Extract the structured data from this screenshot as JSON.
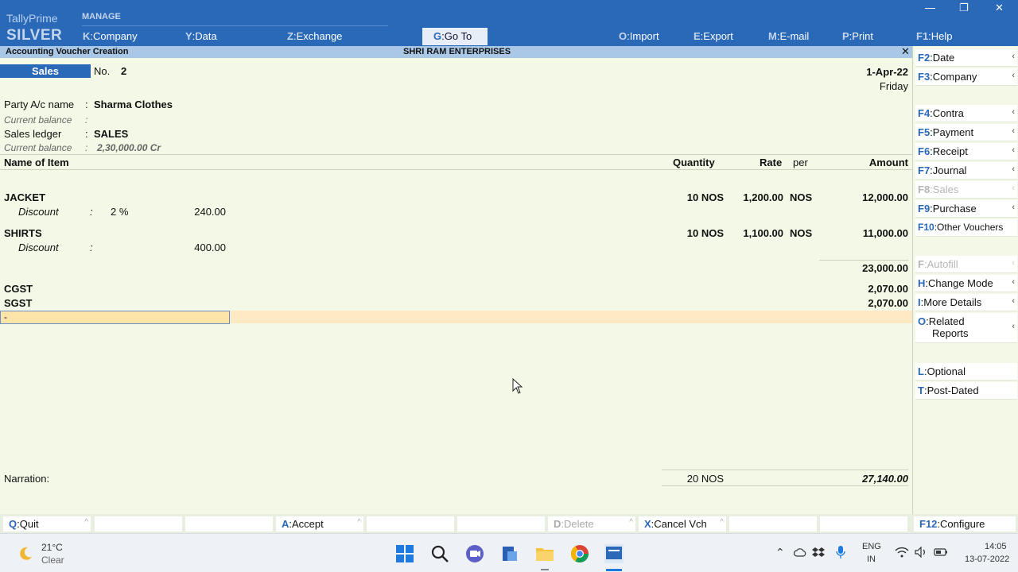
{
  "brand": {
    "line1": "TallyPrime",
    "line2": "SILVER"
  },
  "topmenu": {
    "manage_label": "MANAGE",
    "items": [
      {
        "key": "K",
        "label": "Company"
      },
      {
        "key": "Y",
        "label": "Data"
      },
      {
        "key": "Z",
        "label": "Exchange"
      },
      {
        "key": "G",
        "label": "Go To"
      },
      {
        "key": "O",
        "label": "Import"
      },
      {
        "key": "E",
        "label": "Export"
      },
      {
        "key": "M",
        "label": "E-mail"
      },
      {
        "key": "P",
        "label": "Print"
      },
      {
        "key": "F1",
        "label": "Help"
      }
    ]
  },
  "window": {
    "minimize": "—",
    "restore": "❐",
    "close": "✕"
  },
  "titlebar": {
    "screen": "Accounting Voucher Creation",
    "company": "SHRI RAM ENTERPRISES",
    "close": "✕"
  },
  "voucher": {
    "type": "Sales",
    "no_label": "No.",
    "no": "2",
    "date": "1-Apr-22",
    "day": "Friday",
    "party_label": "Party A/c name",
    "party": "Sharma Clothes",
    "current_balance_label": "Current balance",
    "party_balance": "",
    "sales_ledger_label": "Sales ledger",
    "sales_ledger": "SALES",
    "ledger_balance": "2,30,000.00 Cr",
    "colon": ":"
  },
  "columns": {
    "name": "Name of Item",
    "quantity": "Quantity",
    "rate": "Rate",
    "per": "per",
    "amount": "Amount"
  },
  "items": [
    {
      "name": "JACKET",
      "qty": "10 NOS",
      "rate": "1,200.00",
      "per": "NOS",
      "amount": "12,000.00",
      "disc_label": "Discount",
      "disc_pct": "2 %",
      "disc_amt": "240.00"
    },
    {
      "name": "SHIRTS",
      "qty": "10 NOS",
      "rate": "1,100.00",
      "per": "NOS",
      "amount": "11,000.00",
      "disc_label": "Discount",
      "disc_pct": "",
      "disc_amt": "400.00"
    }
  ],
  "subtotal": "23,000.00",
  "taxes": [
    {
      "name": "CGST",
      "amount": "2,070.00"
    },
    {
      "name": "SGST",
      "amount": "2,070.00"
    }
  ],
  "active_input": "-",
  "footer": {
    "narration_label": "Narration:",
    "total_qty": "20 NOS",
    "total_amount": "27,140.00"
  },
  "rightpanel": [
    {
      "key": "F2",
      "label": "Date"
    },
    {
      "key": "F3",
      "label": "Company"
    },
    {
      "key": "F4",
      "label": "Contra"
    },
    {
      "key": "F5",
      "label": "Payment"
    },
    {
      "key": "F6",
      "label": "Receipt"
    },
    {
      "key": "F7",
      "label": "Journal"
    },
    {
      "key": "F8",
      "label": "Sales"
    },
    {
      "key": "F9",
      "label": "Purchase"
    },
    {
      "key": "F10",
      "label": "Other Vouchers"
    },
    {
      "key": "F",
      "label": "Autofill"
    },
    {
      "key": "H",
      "label": "Change Mode"
    },
    {
      "key": "I",
      "label": "More Details"
    },
    {
      "key": "O",
      "label": "Related",
      "label2": "Reports"
    },
    {
      "key": "L",
      "label": "Optional"
    },
    {
      "key": "T",
      "label": "Post-Dated"
    }
  ],
  "bottombar": [
    {
      "key": "Q",
      "label": "Quit"
    },
    {
      "key": "A",
      "label": "Accept"
    },
    {
      "key": "D",
      "label": "Delete"
    },
    {
      "key": "X",
      "label": "Cancel Vch"
    },
    {
      "key": "F12",
      "label": "Configure"
    }
  ],
  "taskbar": {
    "weather_temp": "21°C",
    "weather_desc": "Clear",
    "lang1": "ENG",
    "lang2": "IN",
    "time": "14:05",
    "date": "13-07-2022"
  },
  "colors": {
    "brand_blue": "#2a68b8",
    "voucher_bg": "#f3f9e6",
    "active_row": "#fde9c4"
  }
}
